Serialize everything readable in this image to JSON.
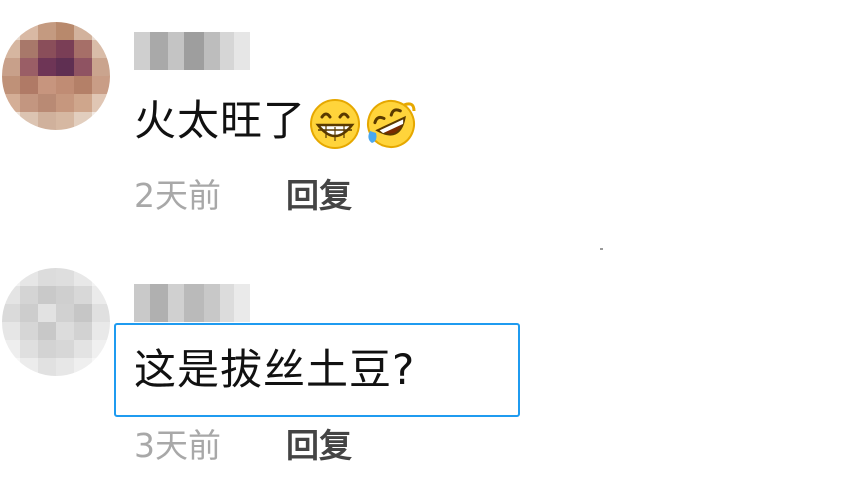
{
  "comments": [
    {
      "text": "火太旺了",
      "emojis": [
        "grinning-face-emoji",
        "rolling-on-floor-laughing-emoji"
      ],
      "time": "2天前",
      "reply_label": "回复",
      "highlighted": false
    },
    {
      "text": "这是拔丝土豆?",
      "emojis": [],
      "time": "3天前",
      "reply_label": "回复",
      "highlighted": true
    }
  ],
  "colors": {
    "highlight_border": "#1f9bf0",
    "time_text": "#a8a8a8",
    "reply_text": "#444444",
    "comment_text": "#111111"
  }
}
